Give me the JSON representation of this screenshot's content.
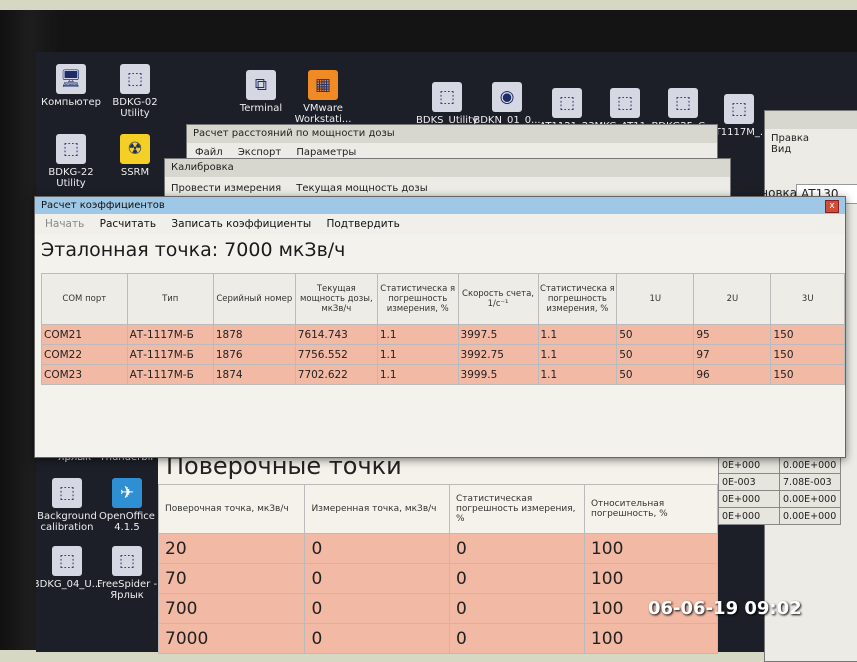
{
  "desktop_icons": [
    {
      "label": "Компьютер",
      "glyph": "🖥"
    },
    {
      "label": "BDKG-02 Utility",
      "glyph": "⬚"
    },
    {
      "label": "BDKG-22 Utility",
      "glyph": "⬚"
    },
    {
      "label": "SSRM",
      "glyph": "☢"
    },
    {
      "label": "Terminal",
      "glyph": "⧉"
    },
    {
      "label": "VMware Workstati...",
      "glyph": "▦"
    },
    {
      "label": "BDKS_Utility",
      "glyph": "⬚"
    },
    {
      "label": "BDKN_01_0...",
      "glyph": "◉"
    },
    {
      "label": "AT1121_23",
      "glyph": "⬚"
    },
    {
      "label": "MKC_AT11...",
      "glyph": "⬚"
    },
    {
      "label": "BDKG25_C...",
      "glyph": "⬚"
    },
    {
      "label": "AT1117M_...",
      "glyph": "⬚"
    },
    {
      "label": "- Ярлык",
      "glyph": ""
    },
    {
      "label": "Thunderbir",
      "glyph": ""
    },
    {
      "label": "Background calibration",
      "glyph": "⬚"
    },
    {
      "label": "OpenOffice 4.1.5",
      "glyph": "✈"
    },
    {
      "label": "BDKG_04_U...",
      "glyph": "⬚"
    },
    {
      "label": "FreeSpider - Ярлык",
      "glyph": "⬚"
    }
  ],
  "bg_window_1": {
    "title": "Расчет расстояний по мощности дозы",
    "menu": [
      "Файл",
      "Экспорт",
      "Параметры"
    ]
  },
  "bg_window_2": {
    "title": "Калибровка",
    "menu": [
      "Провести измерения",
      "Текущая мощность дозы"
    ],
    "install_label": "Установка:",
    "install_value": "AT130"
  },
  "bg_window_3": {
    "menu": [
      "Правка",
      "Вид"
    ]
  },
  "main_window": {
    "title": "Расчет коэффициентов",
    "close_glyph": "x",
    "menu": [
      "Начать",
      "Расчитать",
      "Записать коэффициенты",
      "Подтвердить"
    ],
    "ref_point": "Эталонная точка: 7000 мкЗв/ч",
    "columns": [
      "COM порт",
      "Тип",
      "Серийный номер",
      "Текущая мощность дозы, мкЗв/ч",
      "Статистическа я погрешность измерения, %",
      "Скорость счета, 1/с⁻¹",
      "Статистическа я погрешность измерения, %",
      "1U",
      "2U",
      "3U"
    ],
    "rows": [
      [
        "COM21",
        "АТ-1117М-Б",
        "1878",
        "7614.743",
        "1.1",
        "3997.5",
        "1.1",
        "50",
        "95",
        "150"
      ],
      [
        "COM22",
        "АТ-1117М-Б",
        "1876",
        "7756.552",
        "1.1",
        "3992.75",
        "1.1",
        "50",
        "97",
        "150"
      ],
      [
        "COM23",
        "АТ-1117М-Б",
        "1874",
        "7702.622",
        "1.1",
        "3999.5",
        "1.1",
        "50",
        "96",
        "150"
      ]
    ]
  },
  "verification": {
    "title": "Поверочные точки",
    "columns": [
      "Поверочная точка, мкЗв/ч",
      "Измеренная точка, мкЗв/ч",
      "Статистическая погрешность измерения, %",
      "Относительная погрешность, %"
    ],
    "rows": [
      [
        "20",
        "0",
        "0",
        "100"
      ],
      [
        "70",
        "0",
        "0",
        "100"
      ],
      [
        "700",
        "0",
        "0",
        "100"
      ],
      [
        "7000",
        "0",
        "0",
        "100"
      ]
    ]
  },
  "right_grid": [
    [
      "0E+000",
      "0.00E+000"
    ],
    [
      "0E-003",
      "7.08E-003"
    ],
    [
      "0E+000",
      "0.00E+000"
    ],
    [
      "0E+000",
      "0.00E+000"
    ]
  ],
  "timestamp": "06-06-19 09:02"
}
